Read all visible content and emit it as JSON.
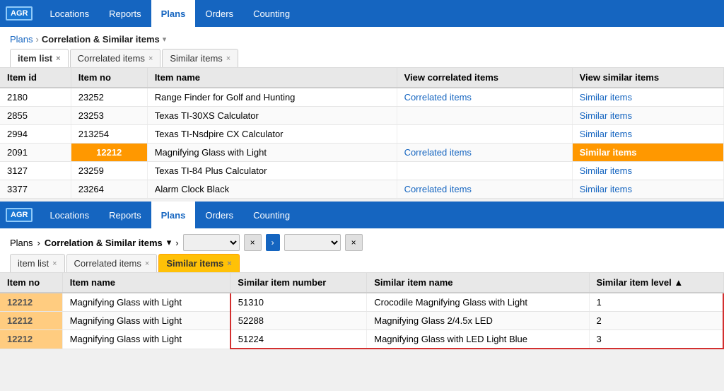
{
  "top": {
    "navbar": {
      "logo": "AGR",
      "items": [
        {
          "label": "Locations",
          "active": false
        },
        {
          "label": "Reports",
          "active": false
        },
        {
          "label": "Plans",
          "active": true
        },
        {
          "label": "Orders",
          "active": false
        },
        {
          "label": "Counting",
          "active": false
        }
      ]
    },
    "breadcrumb": {
      "link": "Plans",
      "sep": "›",
      "current": "Correlation & Similar items",
      "arrow": "▾"
    },
    "tabs": [
      {
        "label": "item list",
        "active": true,
        "highlighted": false
      },
      {
        "label": "Correlated items",
        "active": false,
        "highlighted": false
      },
      {
        "label": "Similar items",
        "active": false,
        "highlighted": false
      }
    ],
    "table": {
      "headers": [
        "Item id",
        "Item no",
        "Item name",
        "View correlated items",
        "View similar items"
      ],
      "rows": [
        {
          "item_id": "2180",
          "item_no": "23252",
          "item_name": "Range Finder for Golf and Hunting",
          "correlated": "Correlated items",
          "similar": "Similar items",
          "highlight_no": false,
          "show_correlated": true,
          "show_similar": true
        },
        {
          "item_id": "2855",
          "item_no": "23253",
          "item_name": "Texas TI-30XS Calculator",
          "correlated": "",
          "similar": "Similar items",
          "highlight_no": false,
          "show_correlated": false,
          "show_similar": true
        },
        {
          "item_id": "2994",
          "item_no": "213254",
          "item_name": "Texas TI-Nsdpire CX Calculator",
          "correlated": "",
          "similar": "Similar items",
          "highlight_no": false,
          "show_correlated": false,
          "show_similar": true
        },
        {
          "item_id": "2091",
          "item_no": "12212",
          "item_name": "Magnifying Glass with Light",
          "correlated": "Correlated items",
          "similar": "Similar items",
          "highlight_no": true,
          "show_correlated": true,
          "show_similar": true,
          "similar_highlighted": true
        },
        {
          "item_id": "3127",
          "item_no": "23259",
          "item_name": "Texas TI-84 Plus Calculator",
          "correlated": "",
          "similar": "Similar items",
          "highlight_no": false,
          "show_correlated": false,
          "show_similar": true
        },
        {
          "item_id": "3377",
          "item_no": "23264",
          "item_name": "Alarm Clock Black",
          "correlated": "Correlated items",
          "similar": "Similar items",
          "highlight_no": false,
          "show_correlated": true,
          "show_similar": true
        }
      ]
    }
  },
  "bottom": {
    "navbar": {
      "logo": "AGR",
      "items": [
        {
          "label": "Locations",
          "active": false
        },
        {
          "label": "Reports",
          "active": false
        },
        {
          "label": "Plans",
          "active": true
        },
        {
          "label": "Orders",
          "active": false
        },
        {
          "label": "Counting",
          "active": false
        }
      ]
    },
    "breadcrumb": {
      "link": "Plans",
      "sep": "›",
      "current": "Correlation & Similar items",
      "arrow": "▾",
      "nav_arrow": "›"
    },
    "filter": {
      "placeholder1": "",
      "placeholder2": ""
    },
    "tabs": [
      {
        "label": "item list",
        "active": false,
        "highlighted": false
      },
      {
        "label": "Correlated items",
        "active": false,
        "highlighted": false
      },
      {
        "label": "Similar items",
        "active": true,
        "highlighted": true
      }
    ],
    "table": {
      "headers": [
        "Item no",
        "Item name",
        "Similar item number",
        "Similar item name",
        "Similar item level ▲"
      ],
      "rows": [
        {
          "item_no": "12212",
          "item_name": "Magnifying Glass with Light",
          "sim_no": "51310",
          "sim_name": "Crocodile Magnifying Glass with Light",
          "sim_level": "1",
          "highlighted": true
        },
        {
          "item_no": "12212",
          "item_name": "Magnifying Glass with Light",
          "sim_no": "52288",
          "sim_name": "Magnifying Glass 2/4.5x LED",
          "sim_level": "2",
          "highlighted": true
        },
        {
          "item_no": "12212",
          "item_name": "Magnifying Glass with Light",
          "sim_no": "51224",
          "sim_name": "Magnifying Glass with LED Light Blue",
          "sim_level": "3",
          "highlighted": true
        }
      ]
    }
  }
}
